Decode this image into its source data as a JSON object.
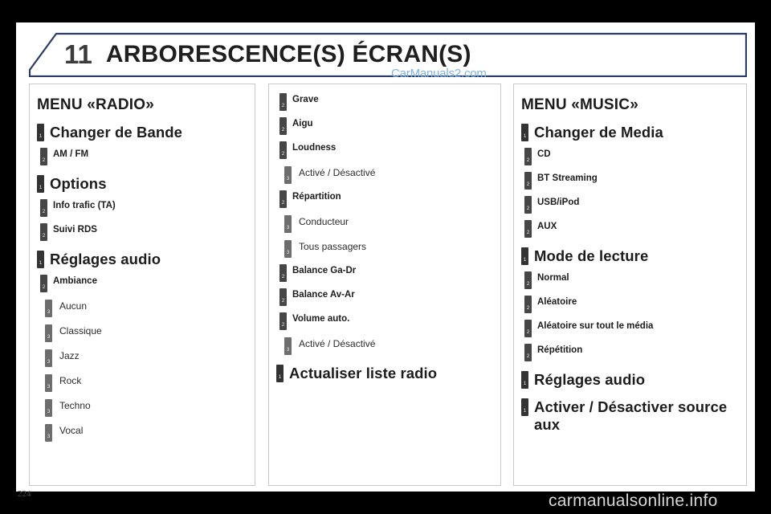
{
  "header": {
    "chapter_number": "11",
    "chapter_title": "ARBORESCENCE(S) ÉCRAN(S)",
    "border_color": "#2b3c66"
  },
  "watermarks": {
    "top": "CarManuals2.com",
    "top_color": "#7fb4e0",
    "bottom": "carmanualsonline.info",
    "bottom_color": "#d7d7d7"
  },
  "footer": {
    "page_number": "224"
  },
  "columns": [
    {
      "id": "col-1",
      "heading": "MENU «RADIO»",
      "items": [
        {
          "level": 1,
          "label": "Changer de Bande"
        },
        {
          "level": 2,
          "label": "AM / FM"
        },
        {
          "level": 1,
          "label": "Options"
        },
        {
          "level": 2,
          "label": "Info trafic (TA)"
        },
        {
          "level": 2,
          "label": "Suivi RDS"
        },
        {
          "level": 1,
          "label": "Réglages audio"
        },
        {
          "level": 2,
          "label": "Ambiance"
        },
        {
          "level": 3,
          "label": "Aucun"
        },
        {
          "level": 3,
          "label": "Classique"
        },
        {
          "level": 3,
          "label": "Jazz"
        },
        {
          "level": 3,
          "label": "Rock"
        },
        {
          "level": 3,
          "label": "Techno"
        },
        {
          "level": 3,
          "label": "Vocal"
        }
      ]
    },
    {
      "id": "col-2",
      "heading": "",
      "items": [
        {
          "level": 2,
          "label": "Grave"
        },
        {
          "level": 2,
          "label": "Aigu"
        },
        {
          "level": 2,
          "label": "Loudness"
        },
        {
          "level": 3,
          "label": "Activé / Désactivé"
        },
        {
          "level": 2,
          "label": "Répartition"
        },
        {
          "level": 3,
          "label": "Conducteur"
        },
        {
          "level": 3,
          "label": "Tous passagers"
        },
        {
          "level": 2,
          "label": "Balance Ga-Dr"
        },
        {
          "level": 2,
          "label": "Balance Av-Ar"
        },
        {
          "level": 2,
          "label": "Volume auto."
        },
        {
          "level": 3,
          "label": "Activé / Désactivé"
        },
        {
          "level": 1,
          "label": "Actualiser liste radio"
        }
      ]
    },
    {
      "id": "col-3",
      "heading": "MENU «MUSIC»",
      "items": [
        {
          "level": 1,
          "label": "Changer de Media"
        },
        {
          "level": 2,
          "label": "CD"
        },
        {
          "level": 2,
          "label": "BT Streaming"
        },
        {
          "level": 2,
          "label": "USB/iPod"
        },
        {
          "level": 2,
          "label": "AUX"
        },
        {
          "level": 1,
          "label": "Mode de lecture"
        },
        {
          "level": 2,
          "label": "Normal"
        },
        {
          "level": 2,
          "label": "Aléatoire"
        },
        {
          "level": 2,
          "label": "Aléatoire sur tout le média"
        },
        {
          "level": 2,
          "label": "Répétition"
        },
        {
          "level": 1,
          "label": "Réglages audio"
        },
        {
          "level": 1,
          "label": "Activer / Désactiver source aux"
        }
      ]
    }
  ]
}
